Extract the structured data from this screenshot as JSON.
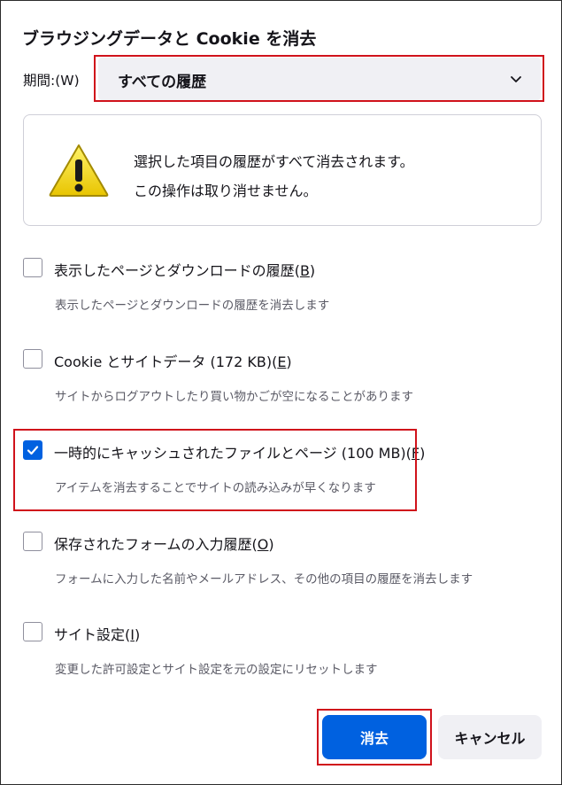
{
  "dialog": {
    "title": "ブラウジングデータと Cookie を消去"
  },
  "period": {
    "label": "期間:(W)",
    "selected": "すべての履歴"
  },
  "warning": {
    "line1": "選択した項目の履歴がすべて消去されます。",
    "line2": "この操作は取り消せません。"
  },
  "options": [
    {
      "label": "表示したページとダウンロードの履歴",
      "accesskey": "B",
      "description": "表示したページとダウンロードの履歴を消去します",
      "checked": false
    },
    {
      "label": "Cookie とサイトデータ (172 KB)",
      "accesskey": "E",
      "description": "サイトからログアウトしたり買い物かごが空になることがあります",
      "checked": false
    },
    {
      "label": "一時的にキャッシュされたファイルとページ (100 MB)",
      "accesskey": "F",
      "description": "アイテムを消去することでサイトの読み込みが早くなります",
      "checked": true
    },
    {
      "label": "保存されたフォームの入力履歴",
      "accesskey": "O",
      "description": "フォームに入力した名前やメールアドレス、その他の項目の履歴を消去します",
      "checked": false
    },
    {
      "label": "サイト設定",
      "accesskey": "I",
      "description": "変更した許可設定とサイト設定を元の設定にリセットします",
      "checked": false
    }
  ],
  "buttons": {
    "clear": "消去",
    "cancel": "キャンセル"
  },
  "colors": {
    "accent": "#0061e0",
    "highlight": "#d0121b",
    "select_bg": "#f0f0f4"
  },
  "icons": {
    "warning": "warning-triangle-icon",
    "dropdown": "chevron-down-icon",
    "check": "checkmark-icon"
  }
}
